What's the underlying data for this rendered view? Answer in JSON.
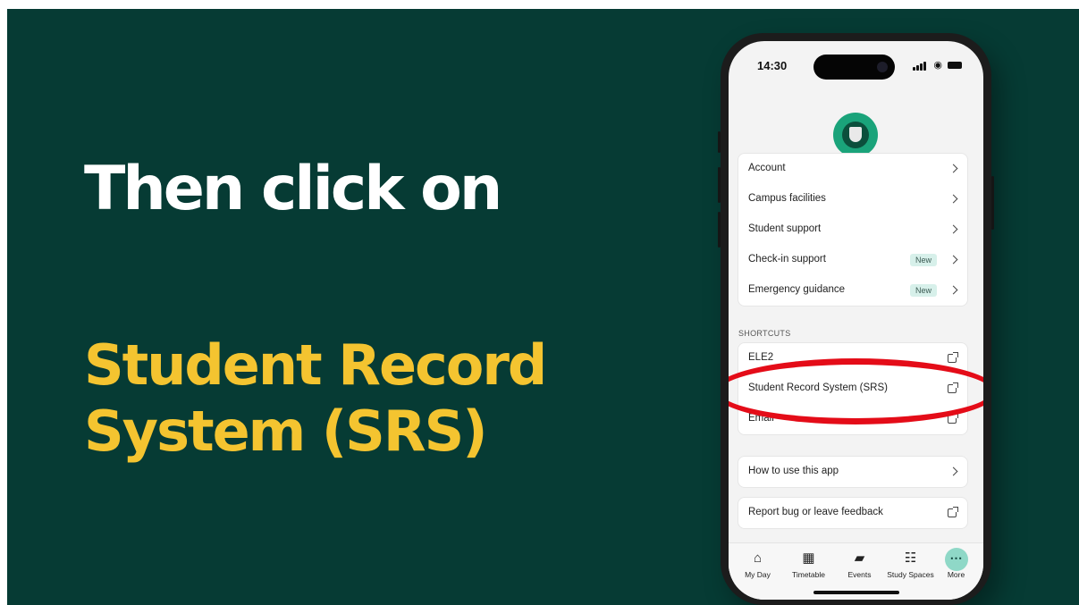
{
  "slide": {
    "headline": "Then click on",
    "subline": [
      "Student Record",
      "System (SRS)"
    ]
  },
  "phone": {
    "status_bar": {
      "time": "14:30"
    },
    "menu": [
      {
        "label": "Account",
        "badge": null,
        "action": "chevron"
      },
      {
        "label": "Campus facilities",
        "badge": null,
        "action": "chevron"
      },
      {
        "label": "Student support",
        "badge": null,
        "action": "chevron"
      },
      {
        "label": "Check-in support",
        "badge": "New",
        "action": "chevron"
      },
      {
        "label": "Emergency guidance",
        "badge": "New",
        "action": "chevron"
      }
    ],
    "shortcuts_label": "SHORTCUTS",
    "shortcuts": [
      {
        "label": "ELE2",
        "action": "external"
      },
      {
        "label": "Student Record System (SRS)",
        "action": "external"
      },
      {
        "label": "Email",
        "action": "external"
      }
    ],
    "help": {
      "label": "How to use this app",
      "action": "chevron"
    },
    "feedback": {
      "label": "Report bug or leave feedback",
      "action": "external"
    },
    "tabs": [
      {
        "label": "My Day",
        "icon": "home-icon"
      },
      {
        "label": "Timetable",
        "icon": "calendar-icon"
      },
      {
        "label": "Events",
        "icon": "ticket-icon"
      },
      {
        "label": "Study Spaces",
        "icon": "book-icon"
      },
      {
        "label": "More",
        "icon": "more-icon",
        "active": true
      }
    ]
  },
  "colors": {
    "background": "#063b34",
    "headline": "#ffffff",
    "subline": "#f4c430",
    "highlight": "#e40c18",
    "accent": "#8fd8c7"
  }
}
